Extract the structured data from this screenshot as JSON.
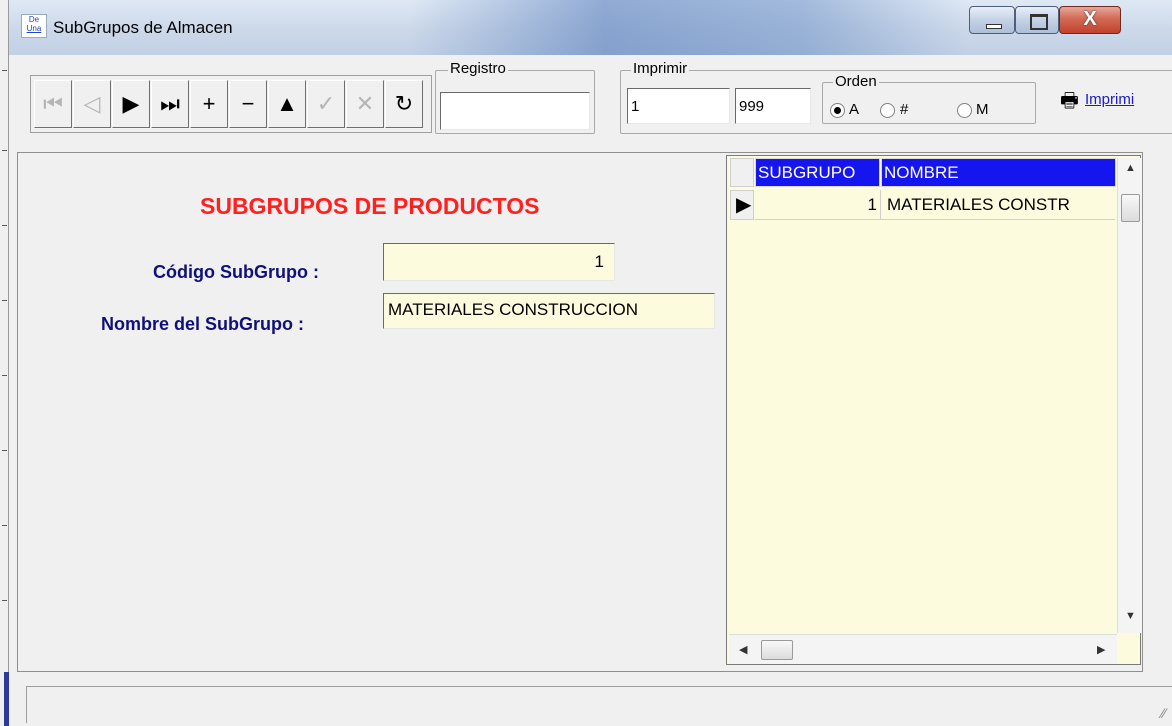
{
  "window": {
    "title": "SubGrupos de Almacen",
    "icon_label_top": "De",
    "icon_label_bottom": "Una"
  },
  "toolbar": {
    "nav_buttons": [
      {
        "name": "first-record",
        "glyph": "⏮",
        "enabled": false
      },
      {
        "name": "previous-record",
        "glyph": "◁",
        "enabled": false
      },
      {
        "name": "next-record",
        "glyph": "▶",
        "enabled": true
      },
      {
        "name": "last-record",
        "glyph": "⏭",
        "enabled": true
      },
      {
        "name": "add-record",
        "glyph": "+",
        "enabled": true
      },
      {
        "name": "delete-record",
        "glyph": "−",
        "enabled": true
      },
      {
        "name": "edit-record",
        "glyph": "▲",
        "enabled": true
      },
      {
        "name": "confirm-record",
        "glyph": "✓",
        "enabled": false
      },
      {
        "name": "cancel-record",
        "glyph": "✕",
        "enabled": false
      },
      {
        "name": "refresh",
        "glyph": "↻",
        "enabled": true
      }
    ],
    "registro_label": "Registro",
    "registro_value": "",
    "imprimir_label": "Imprimir",
    "imprimir_from": "1",
    "imprimir_to": "999",
    "orden_label": "Orden",
    "orden_options": [
      "A",
      "#",
      "M"
    ],
    "orden_selected": "A",
    "print_button_label": "Imprimi"
  },
  "form": {
    "heading": "SUBGRUPOS DE PRODUCTOS",
    "codigo_label": "Código SubGrupo  :",
    "codigo_value": "1",
    "nombre_label": "Nombre del SubGrupo  :",
    "nombre_value": "MATERIALES CONSTRUCCION"
  },
  "grid": {
    "columns": [
      "SUBGRUPO",
      "NOMBRE"
    ],
    "rows": [
      {
        "subgrupo": "1",
        "nombre": "MATERIALES CONSTR"
      }
    ]
  },
  "colors": {
    "heading": "#ff2020",
    "label": "#10107a",
    "grid_header": "#1515ef",
    "field_background": "#fdfbdd"
  }
}
